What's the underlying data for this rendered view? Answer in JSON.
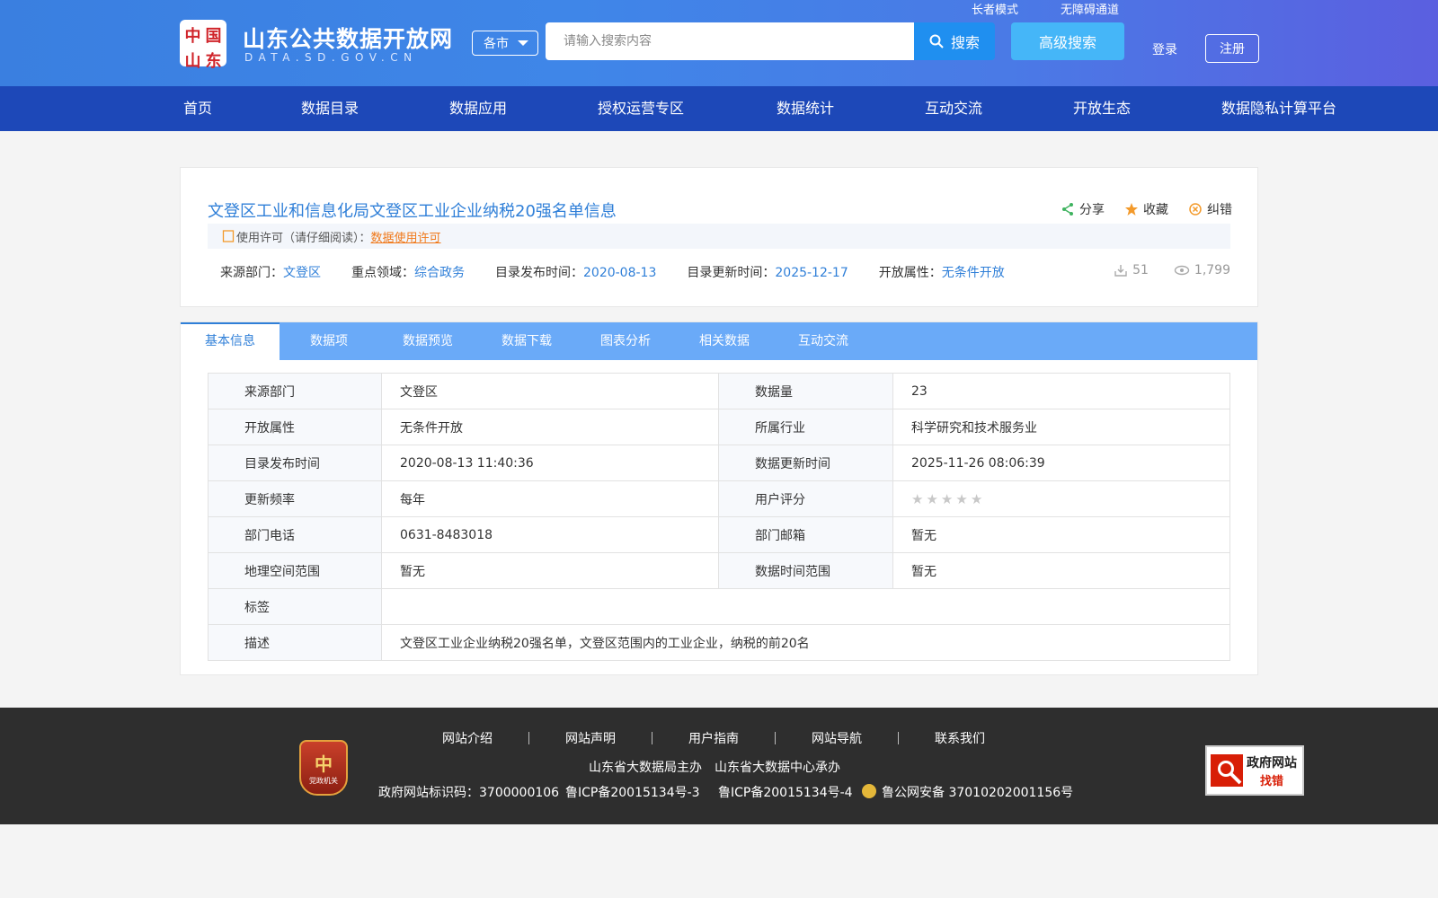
{
  "header": {
    "logo_seal_chars": [
      "中",
      "国",
      "山",
      "东"
    ],
    "site_title": "山东公共数据开放网",
    "site_sub": "DATA.SD.GOV.CN",
    "city_select": "各市",
    "search_placeholder": "请输入搜索内容",
    "search_button": "搜索",
    "advanced_search": "高级搜索",
    "elder_mode": "长者模式",
    "accessible": "无障碍通道",
    "login": "登录",
    "register": "注册"
  },
  "nav": [
    "首页",
    "数据目录",
    "数据应用",
    "授权运营专区",
    "数据统计",
    "互动交流",
    "开放生态",
    "数据隐私计算平台"
  ],
  "dataset": {
    "title": "文登区工业和信息化局文登区工业企业纳税20强名单信息",
    "share": "分享",
    "favorite": "收藏",
    "report": "纠错",
    "license_label": "使用许可（请仔细阅读）：",
    "license_link": "数据使用许可",
    "meta": [
      {
        "k": "来源部门：",
        "v": "文登区"
      },
      {
        "k": "重点领域：",
        "v": "综合政务"
      },
      {
        "k": "目录发布时间：",
        "v": "2020-08-13"
      },
      {
        "k": "目录更新时间：",
        "v": "2025-12-17"
      },
      {
        "k": "开放属性：",
        "v": "无条件开放"
      }
    ],
    "downloads": "51",
    "views": "1,799"
  },
  "tabs": [
    "基本信息",
    "数据项",
    "数据预览",
    "数据下载",
    "图表分析",
    "相关数据",
    "互动交流"
  ],
  "info_table": [
    [
      "来源部门",
      "文登区",
      "数据量",
      "23"
    ],
    [
      "开放属性",
      "无条件开放",
      "所属行业",
      "科学研究和技术服务业"
    ],
    [
      "目录发布时间",
      "2020-08-13 11:40:36",
      "数据更新时间",
      "2025-11-26 08:06:39"
    ],
    [
      "更新频率",
      "每年",
      "用户评分",
      ""
    ],
    [
      "部门电话",
      "0631-8483018",
      "部门邮箱",
      "暂无"
    ],
    [
      "地理空间范围",
      "暂无",
      "数据时间范围",
      "暂无"
    ],
    [
      "标签",
      ""
    ],
    [
      "描述",
      "文登区工业企业纳税20强名单，文登区范围内的工业企业，纳税的前20名"
    ]
  ],
  "rating_stars": 0,
  "colors": {
    "header_blue": "#3f86e8",
    "nav_blue": "#1d48b8",
    "tab_bar": "#6aaaf8",
    "link_blue": "#2f7fd8",
    "license_orange": "#f0791b",
    "footer_bg": "#2e2e2e"
  },
  "footer": {
    "links": [
      "网站介绍",
      "网站声明",
      "用户指南",
      "网站导航",
      "联系我们"
    ],
    "line1": "山东省大数据局主办　山东省大数据中心承办",
    "line2_a": "政府网站标识码：3700000106",
    "line2_b": "鲁ICP备20015134号-3",
    "line2_c": "鲁ICP备20015134号-4",
    "line2_d": "鲁公网安备 37010202001156号",
    "emblem_char": "中",
    "emblem_text": "党政机关",
    "gov_badge_1": "政府网站",
    "gov_badge_2": "找错"
  }
}
